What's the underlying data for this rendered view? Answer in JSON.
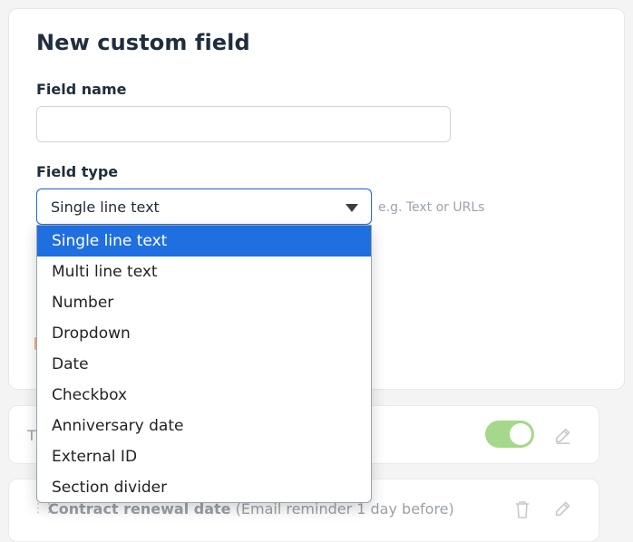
{
  "form": {
    "title": "New custom field",
    "field_name_label": "Field name",
    "field_name_value": "",
    "field_type_label": "Field type",
    "field_type_selected": "Single line text",
    "hint": "e.g. Text or URLs"
  },
  "dropdown": {
    "options": [
      "Single line text",
      "Multi line text",
      "Number",
      "Dropdown",
      "Date",
      "Checkbox",
      "Anniversary date",
      "External ID",
      "Section divider"
    ],
    "selected_index": 0
  },
  "background_rows": {
    "row1_visible_text": "T",
    "row1_toggle_on": true,
    "row2_title": "Contract renewal date",
    "row2_subtitle": "(Email reminder 1 day before)"
  },
  "colors": {
    "accent": "#1f6fe0",
    "toggle_on": "#a5d88a"
  }
}
